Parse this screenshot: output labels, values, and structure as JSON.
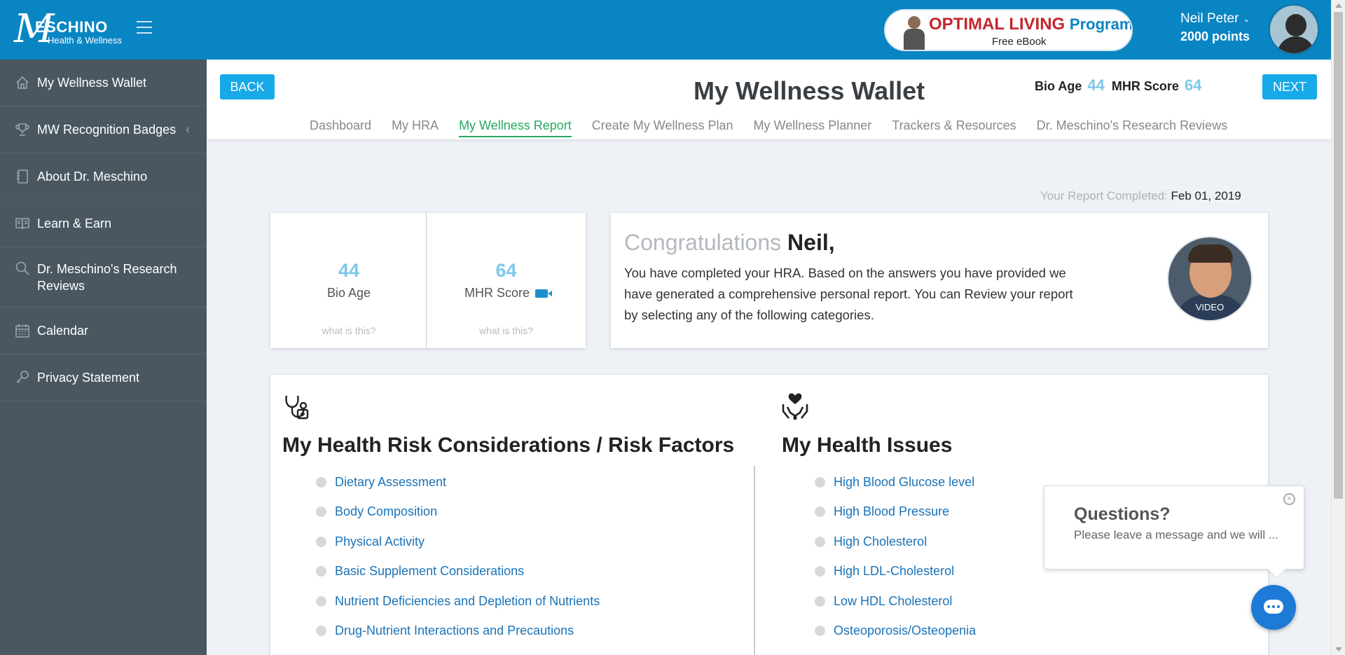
{
  "header": {
    "logo_mark": "M",
    "logo_brand": "ESCHINO",
    "logo_tag": "Health & Wellness",
    "promo_title": "OPTIMAL LIVING",
    "promo_title_suffix": "Program",
    "promo_sub": "Free eBook",
    "user_name": "Neil Peter",
    "user_points": "2000 points"
  },
  "sidebar": {
    "items": [
      {
        "label": "My Wellness Wallet",
        "icon": "home-icon"
      },
      {
        "label": "MW Recognition Badges",
        "icon": "trophy-icon",
        "caret": "‹"
      },
      {
        "label": "About Dr. Meschino",
        "icon": "notebook-icon"
      },
      {
        "label": "Learn & Earn",
        "icon": "book-icon"
      },
      {
        "label": "Dr. Meschino's Research Reviews",
        "icon": "search-icon"
      },
      {
        "label": "Calendar",
        "icon": "calendar-icon"
      },
      {
        "label": "Privacy Statement",
        "icon": "key-icon"
      }
    ]
  },
  "main": {
    "back_label": "BACK",
    "next_label": "NEXT",
    "title": "My Wellness Wallet",
    "bio_age_label": "Bio Age",
    "bio_age_value": "44",
    "mhr_label": "MHR Score",
    "mhr_value": "64",
    "tabs": [
      "Dashboard",
      "My HRA",
      "My Wellness Report",
      "Create My Wellness Plan",
      "My Wellness Planner",
      "Trackers & Resources",
      "Dr. Meschino's Research Reviews"
    ],
    "active_tab": "My Wellness Report",
    "report_label": "Your Report Completed:",
    "report_date": "Feb 01, 2019"
  },
  "stats": {
    "bio_age_value": "44",
    "bio_age_label": "Bio Age",
    "mhr_value": "64",
    "mhr_label": "MHR Score",
    "what_label": "what is this?"
  },
  "congrats": {
    "greeting": "Congratulations",
    "name": "Neil,",
    "text": "You have completed your HRA. Based on the answers you have provided we have generated a comprehensive personal report. You can Review your report by selecting any of the following categories.",
    "video_label": "VIDEO"
  },
  "risk": {
    "title": "My Health Risk Considerations / Risk Factors",
    "items": [
      "Dietary Assessment",
      "Body Composition",
      "Physical Activity",
      "Basic Supplement Considerations",
      "Nutrient Deficiencies and Depletion of Nutrients",
      "Drug-Nutrient Interactions and Precautions"
    ]
  },
  "issues": {
    "title": "My Health Issues",
    "items": [
      "High Blood Glucose level",
      "High Blood Pressure",
      "High Cholesterol",
      "High LDL-Cholesterol",
      "Low HDL Cholesterol",
      "Osteoporosis/Osteopenia"
    ]
  },
  "chat": {
    "title": "Questions?",
    "message": "Please leave a message and we will ...",
    "close": "×"
  },
  "colors": {
    "header_blue": "#0a85c3",
    "sidebar_gray": "#4a5761",
    "button_blue": "#18a9e8",
    "active_green": "#27a862",
    "stat_blue": "#7ec8ea",
    "link_blue": "#1a73b8"
  }
}
